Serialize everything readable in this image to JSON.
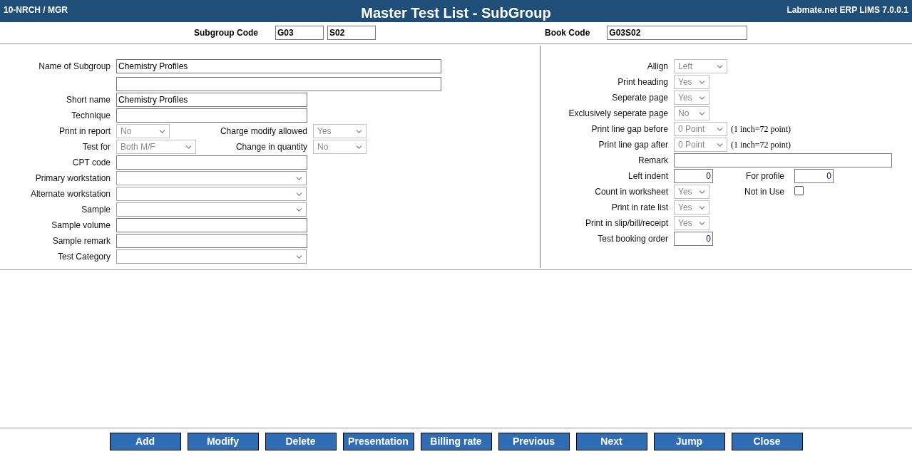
{
  "header": {
    "left": "10-NRCH / MGR",
    "title": "Master Test List - SubGroup",
    "right": "Labmate.net ERP LIMS 7.0.0.1"
  },
  "codes": {
    "subgroup_label": "Subgroup Code",
    "subgroup_values": [
      "G03",
      "S02"
    ],
    "book_label": "Book Code",
    "book_value": "G03S02"
  },
  "left_rows": [
    [
      {
        "kind": "text",
        "label": "Name of Subgroup",
        "value": "Chemistry Profiles"
      }
    ],
    [
      {
        "kind": "text"
      }
    ],
    [
      {
        "kind": "text",
        "label": "Short name",
        "value": "Chemistry Profiles"
      }
    ],
    [
      {
        "kind": "text",
        "label": "Technique"
      }
    ],
    [
      {
        "kind": "select",
        "label": "Print in report",
        "value": "No",
        "disabled": true
      },
      {
        "kind": "select",
        "label": "Charge modify allowed",
        "value": "Yes",
        "disabled": true
      }
    ],
    [
      {
        "kind": "select",
        "label": "Test for",
        "value": "Both M/F",
        "disabled": true
      },
      {
        "kind": "select",
        "label": "Change in quantity",
        "value": "No",
        "disabled": true
      }
    ],
    [
      {
        "kind": "text",
        "label": "CPT code"
      }
    ],
    [
      {
        "kind": "select",
        "label": "Primary workstation",
        "disabled": false
      }
    ],
    [
      {
        "kind": "select",
        "label": "Alternate workstation",
        "disabled": false
      }
    ],
    [
      {
        "kind": "select",
        "label": "Sample",
        "disabled": false
      }
    ],
    [
      {
        "kind": "text",
        "label": "Sample volume"
      }
    ],
    [
      {
        "kind": "text",
        "label": "Sample remark"
      }
    ],
    [
      {
        "kind": "select",
        "label": "Test Category",
        "disabled": false
      }
    ]
  ],
  "right_rows": [
    [
      {
        "kind": "select",
        "label": "Allign",
        "value": "Left",
        "disabled": true
      }
    ],
    [
      {
        "kind": "select",
        "label": "Print heading",
        "value": "Yes",
        "disabled": true
      }
    ],
    [
      {
        "kind": "select",
        "label": "Seperate page",
        "value": "Yes",
        "disabled": true
      }
    ],
    [
      {
        "kind": "select",
        "label": "Exclusively seperate page",
        "value": "No",
        "disabled": true
      }
    ],
    [
      {
        "kind": "select",
        "label": "Print line gap before",
        "value": "0 Point",
        "disabled": true,
        "note": "(1 inch=72 point)"
      }
    ],
    [
      {
        "kind": "select",
        "label": "Print line gap after",
        "value": "0 Point",
        "disabled": true,
        "note": "(1 inch=72 point)"
      }
    ],
    [
      {
        "kind": "text",
        "label": "Remark"
      }
    ],
    [
      {
        "kind": "number",
        "label": "Left indent",
        "value": "0"
      },
      {
        "kind": "number",
        "label": "For profile",
        "value": "0"
      }
    ],
    [
      {
        "kind": "select",
        "label": "Count in worksheet",
        "value": "Yes",
        "disabled": true
      },
      {
        "kind": "checkbox",
        "label": "Not in Use",
        "checked": false
      }
    ],
    [
      {
        "kind": "select",
        "label": "Print in rate list",
        "value": "Yes",
        "disabled": true
      }
    ],
    [
      {
        "kind": "select",
        "label": "Print in slip/bill/receipt",
        "value": "Yes",
        "disabled": true
      }
    ],
    [
      {
        "kind": "number",
        "label": "Test booking order",
        "value": "0"
      }
    ]
  ],
  "buttons": [
    "Add",
    "Modify",
    "Delete",
    "Presentation",
    "Billing rate",
    "Previous",
    "Next",
    "Jump",
    "Close"
  ]
}
